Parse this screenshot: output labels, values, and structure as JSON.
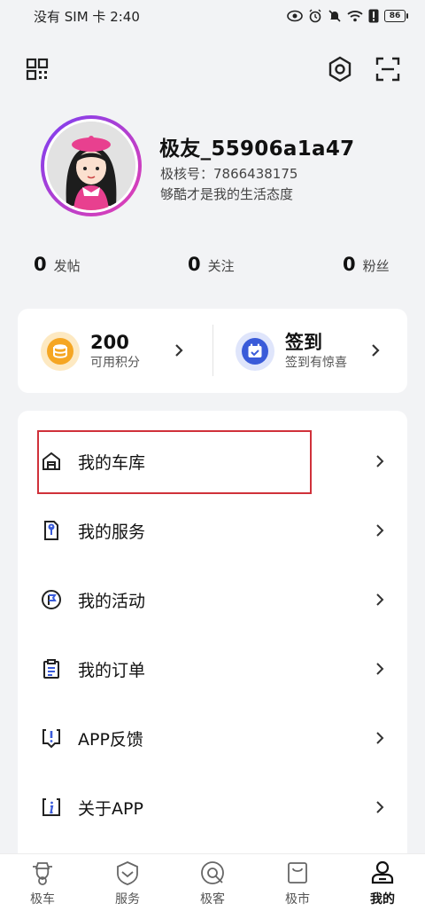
{
  "status_bar": {
    "carrier_time": "没有 SIM 卡 2:40",
    "battery": "86"
  },
  "profile": {
    "username": "极友_55906a1a47",
    "user_id": "极核号：7866438175",
    "signature": "够酷才是我的生活态度"
  },
  "stats": [
    {
      "num": "0",
      "label": "发帖"
    },
    {
      "num": "0",
      "label": "关注"
    },
    {
      "num": "0",
      "label": "粉丝"
    }
  ],
  "points": {
    "value": "200",
    "label": "可用积分"
  },
  "checkin": {
    "title": "签到",
    "subtitle": "签到有惊喜"
  },
  "menu": [
    {
      "label": "我的车库",
      "icon": "garage-icon"
    },
    {
      "label": "我的服务",
      "icon": "service-icon"
    },
    {
      "label": "我的活动",
      "icon": "activity-flag-icon"
    },
    {
      "label": "我的订单",
      "icon": "order-clipboard-icon"
    },
    {
      "label": "APP反馈",
      "icon": "feedback-icon"
    },
    {
      "label": "关于APP",
      "icon": "info-icon"
    }
  ],
  "tabs": [
    {
      "label": "极车",
      "icon": "scooter-icon"
    },
    {
      "label": "服务",
      "icon": "service-shield-icon"
    },
    {
      "label": "极客",
      "icon": "geek-icon"
    },
    {
      "label": "极市",
      "icon": "shopping-bag-icon"
    },
    {
      "label": "我的",
      "icon": "profile-icon"
    }
  ],
  "colors": {
    "highlight": "#d0313a",
    "avatar_ring_start": "#7b3ff2",
    "avatar_ring_end": "#e63fb0",
    "points_coin": "#f5a623",
    "checkin_badge": "#3a5bd9"
  }
}
